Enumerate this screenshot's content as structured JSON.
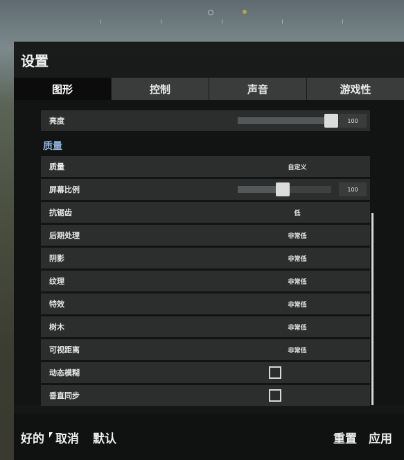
{
  "window": {
    "title": "设置"
  },
  "tabs": [
    {
      "label": "图形",
      "active": true
    },
    {
      "label": "控制",
      "active": false
    },
    {
      "label": "声音",
      "active": false
    },
    {
      "label": "游戏性",
      "active": false
    }
  ],
  "brightness": {
    "label": "亮度",
    "value": "100",
    "level": 1.0
  },
  "quality_section": {
    "title": "质量"
  },
  "settings": {
    "quality": {
      "label": "质量",
      "value": "自定义"
    },
    "screen_scale": {
      "label": "屏幕比例",
      "value": "100",
      "level": 0.5
    },
    "antialiasing": {
      "label": "抗锯齿",
      "value": "低"
    },
    "post_processing": {
      "label": "后期处理",
      "value": "非常低"
    },
    "shadows": {
      "label": "阴影",
      "value": "非常低"
    },
    "textures": {
      "label": "纹理",
      "value": "非常低"
    },
    "effects": {
      "label": "特效",
      "value": "非常低"
    },
    "foliage": {
      "label": "树木",
      "value": "非常低"
    },
    "view_distance": {
      "label": "可视距离",
      "value": "非常低"
    },
    "motion_blur": {
      "label": "动态模糊",
      "checked": false
    },
    "vsync": {
      "label": "垂直同步",
      "checked": false
    }
  },
  "footer": {
    "ok": "好的",
    "cancel": "取消",
    "default": "默认",
    "reset": "重置",
    "apply": "应用"
  },
  "colors": {
    "accent_section": "#8fb1d6",
    "panel_bg": "#121313",
    "row_bg": "#2c2d2d"
  }
}
